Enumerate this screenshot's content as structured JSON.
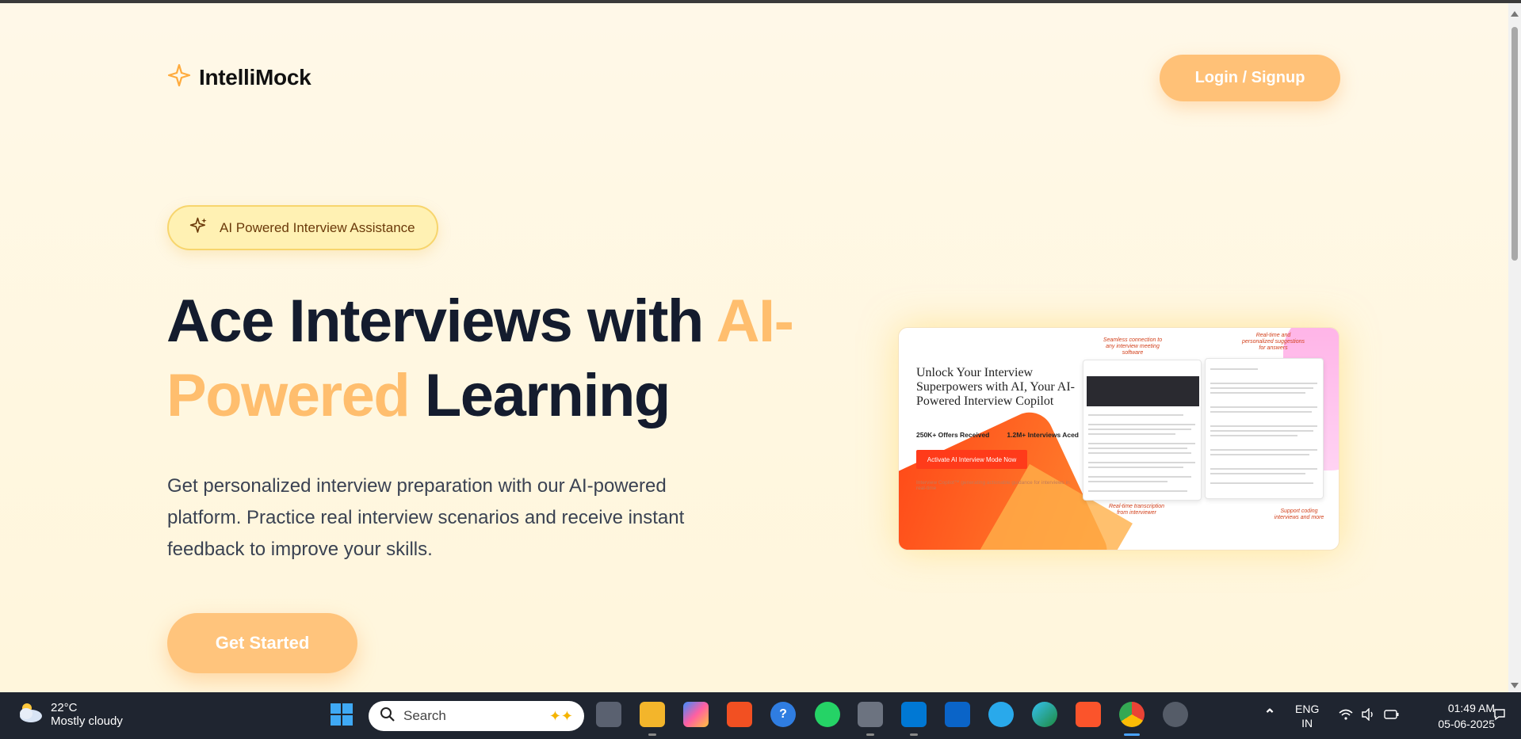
{
  "header": {
    "logo_text": "IntelliMock",
    "login_label": "Login / Signup"
  },
  "hero": {
    "badge_text": "AI Powered Interview Assistance",
    "title_part1": "Ace Interviews with ",
    "title_highlight": "AI-Powered",
    "title_part2": " Learning",
    "description": "Get personalized interview preparation with our AI-powered platform. Practice real interview scenarios and receive instant feedback to improve your skills.",
    "cta_label": "Get Started"
  },
  "preview": {
    "title": "Unlock Your Interview Superpowers with AI, Your AI-Powered Interview Copilot",
    "stat1": "250K+ Offers Received",
    "stat2": "1.2M+ Interviews Aced",
    "button": "Activate AI Interview Mode Now",
    "subtext": "Interview Copilot™ generating actionable guidance for interviews in real-time",
    "note_top1": "Seamless connection to any interview meeting software",
    "note_top2": "Real-time and personalized suggestions for answers",
    "note_bottom1": "Real-time transcription from interviewer",
    "note_bottom2": "Support coding interviews and more"
  },
  "taskbar": {
    "weather_temp": "22°C",
    "weather_desc": "Mostly cloudy",
    "search_placeholder": "Search",
    "lang_line1": "ENG",
    "lang_line2": "IN",
    "time": "01:49 AM",
    "date": "05-06-2025"
  },
  "colors": {
    "accent": "#ffc177",
    "title_dark": "#141c2e",
    "highlight": "#ffbe6e",
    "badge_bg": "#fff1b3",
    "taskbar_bg": "#1f2530"
  },
  "icons": [
    "sparkle-icon",
    "search-icon",
    "windows-start-icon",
    "task-view-icon",
    "file-explorer-icon",
    "copilot-icon",
    "store-icon",
    "help-icon",
    "whatsapp-icon",
    "camera-icon",
    "vscode-icon",
    "outlook-icon",
    "telegram-icon",
    "edge-icon",
    "brave-icon",
    "chrome-icon",
    "settings-icon",
    "chevron-up-icon",
    "wifi-icon",
    "volume-icon",
    "battery-icon",
    "notification-icon",
    "weather-cloud-icon"
  ]
}
